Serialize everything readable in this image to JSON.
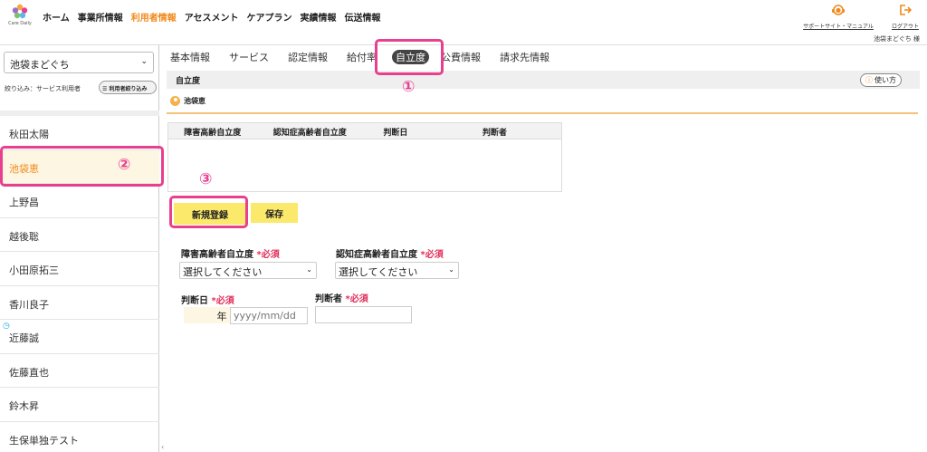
{
  "app": {
    "logo_text": "Care Daily"
  },
  "nav": [
    "ホーム",
    "事業所情報",
    "利用者情報",
    "アセスメント",
    "ケアプラン",
    "実績情報",
    "伝送情報"
  ],
  "nav_active_index": 2,
  "header": {
    "support_label": "サポートサイト・マニュアル",
    "logout_label": "ログアウト",
    "user_name": "池袋まどぐち 様"
  },
  "sidebar": {
    "office_select": "池袋まどぐち",
    "filter_label": "絞り込み：サービス利用者",
    "filter_button": "利用者絞り込み",
    "patients": [
      "秋田太陽",
      "池袋恵",
      "上野昌",
      "越後聡",
      "小田原拓三",
      "香川良子",
      "近藤誠",
      "佐藤直也",
      "鈴木昇",
      "生保単独テスト"
    ],
    "selected_index": 1
  },
  "tabs": [
    "基本情報",
    "サービス",
    "認定情報",
    "給付率",
    "自立度",
    "公費情報",
    "請求先情報"
  ],
  "active_tab_index": 4,
  "section": {
    "title": "自立度",
    "howto": "使い方",
    "person": "池袋恵"
  },
  "grid": {
    "headers": [
      "障害高齢自立度",
      "認知症高齢者自立度",
      "判断日",
      "判断者"
    ]
  },
  "buttons": {
    "new": "新規登録",
    "save": "保存"
  },
  "form": {
    "disability_label": "障害高齢者自立度",
    "dementia_label": "認知症高齢者自立度",
    "date_label": "判断日",
    "judge_label": "判断者",
    "required": "*必須",
    "select_placeholder": "選択してください",
    "year_label": "年",
    "date_placeholder": "yyyy/mm/dd"
  },
  "annotations": [
    "①",
    "②",
    "③"
  ],
  "colors": {
    "accent_orange": "#f08a1c",
    "highlight_pink": "#e8408f",
    "button_yellow": "#fbe96b",
    "required_red": "#e0305a"
  }
}
